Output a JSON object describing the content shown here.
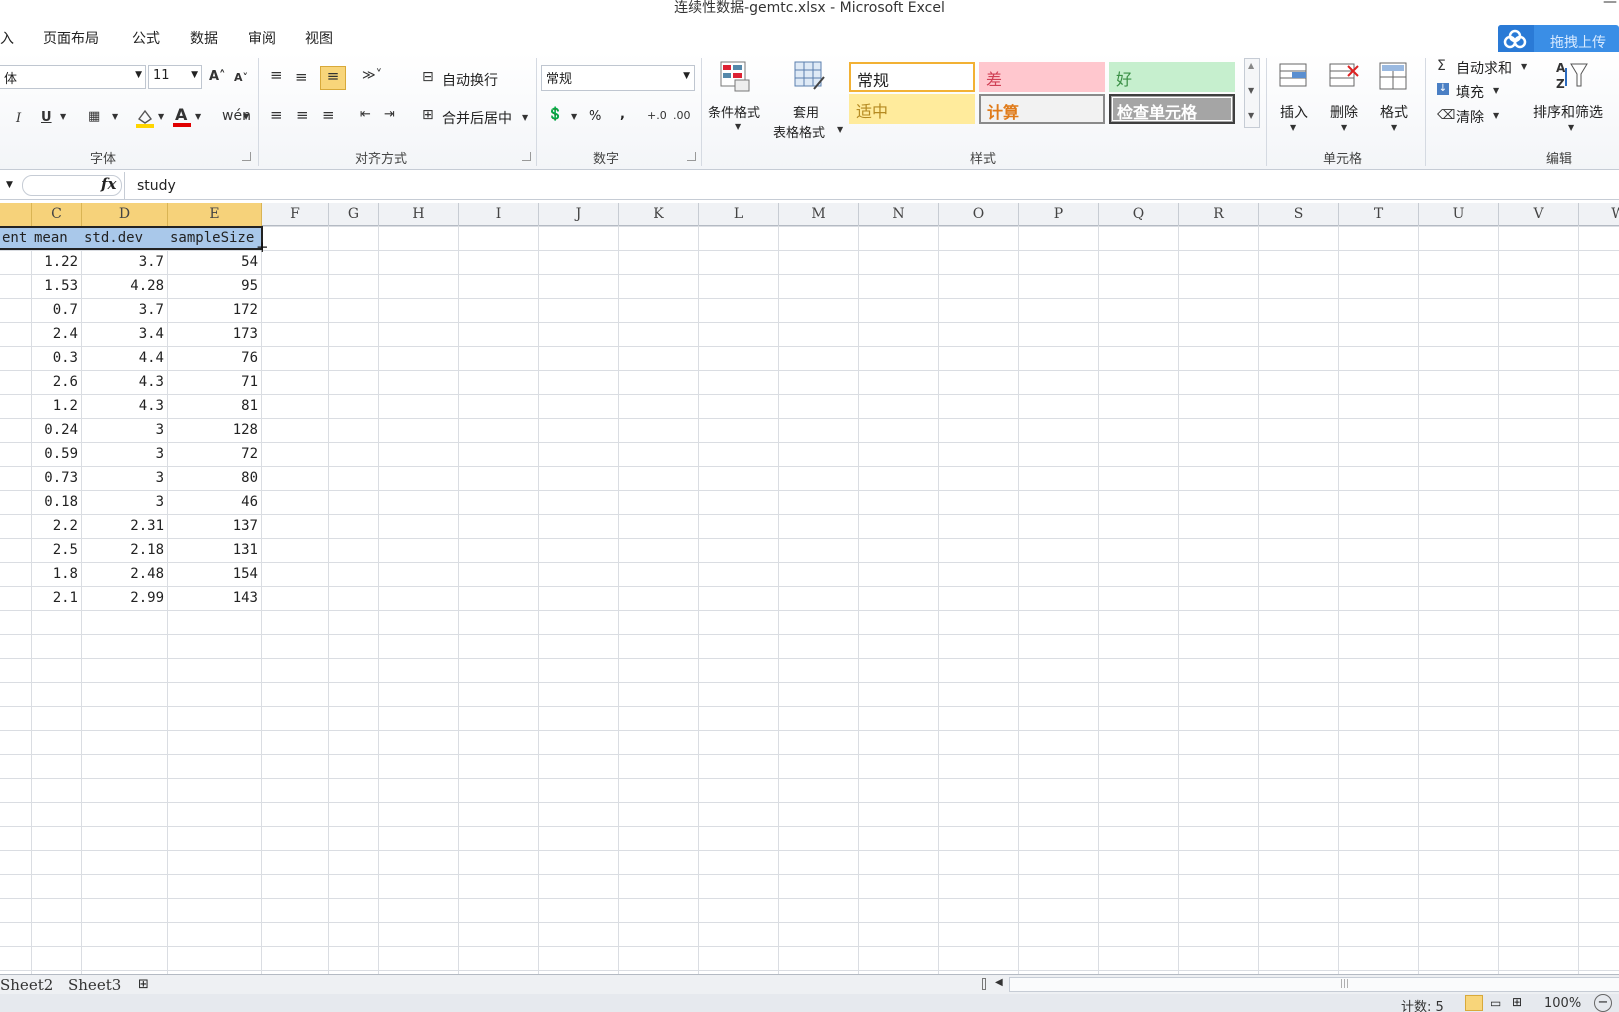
{
  "window": {
    "title": "连续性数据-gemtc.xlsx - Microsoft Excel"
  },
  "menu": {
    "tabs": [
      "入",
      "页面布局",
      "公式",
      "数据",
      "审阅",
      "视图"
    ]
  },
  "upload": {
    "label": "拖拽上传"
  },
  "ribbon": {
    "font": {
      "name": "体",
      "size": "11",
      "group_label": "字体"
    },
    "alignment": {
      "wrap_text": "自动换行",
      "merge_center": "合并后居中",
      "group_label": "对齐方式"
    },
    "number": {
      "format": "常规",
      "percent": "%",
      "comma": ",",
      "group_label": "数字"
    },
    "styles": {
      "conditional": "条件格式",
      "table_format_1": "套用",
      "table_format_2": "表格格式",
      "cells": [
        {
          "label": "常规",
          "bg": "#ffffff",
          "color": "#222222",
          "border": "#f2b134"
        },
        {
          "label": "差",
          "bg": "#ffc7ce",
          "color": "#d04055",
          "border": "#ffc7ce"
        },
        {
          "label": "好",
          "bg": "#c6efce",
          "color": "#3a8f45",
          "border": "#c6efce"
        },
        {
          "label": "适中",
          "bg": "#ffeb9c",
          "color": "#b58a21",
          "border": "#ffeb9c"
        },
        {
          "label": "计算",
          "bg": "#f2f2f2",
          "color": "#e07b1a",
          "border": "#8a8a8a"
        },
        {
          "label": "检查单元格",
          "bg": "#a5a5a5",
          "color": "#ffffff",
          "border": "#3f3f3f"
        }
      ],
      "group_label": "样式"
    },
    "cells": {
      "insert": "插入",
      "delete": "删除",
      "format": "格式",
      "group_label": "单元格"
    },
    "editing": {
      "autosum": "自动求和",
      "fill": "填充",
      "clear": "清除",
      "sort_filter": "排序和筛选",
      "group_label": "编辑"
    }
  },
  "formula_bar": {
    "value": "study"
  },
  "columns": [
    "C",
    "D",
    "E",
    "F",
    "G",
    "H",
    "I",
    "J",
    "K",
    "L",
    "M",
    "N",
    "O",
    "P",
    "Q",
    "R",
    "S",
    "T",
    "U",
    "V",
    "W"
  ],
  "table": {
    "header": [
      "ent",
      "mean",
      "std.dev",
      "sampleSize"
    ],
    "rows": [
      [
        "1.22",
        "3.7",
        "54"
      ],
      [
        "1.53",
        "4.28",
        "95"
      ],
      [
        "0.7",
        "3.7",
        "172"
      ],
      [
        "2.4",
        "3.4",
        "173"
      ],
      [
        "0.3",
        "4.4",
        "76"
      ],
      [
        "2.6",
        "4.3",
        "71"
      ],
      [
        "1.2",
        "4.3",
        "81"
      ],
      [
        "0.24",
        "3",
        "128"
      ],
      [
        "0.59",
        "3",
        "72"
      ],
      [
        "0.73",
        "3",
        "80"
      ],
      [
        "0.18",
        "3",
        "46"
      ],
      [
        "2.2",
        "2.31",
        "137"
      ],
      [
        "2.5",
        "2.18",
        "131"
      ],
      [
        "1.8",
        "2.48",
        "154"
      ],
      [
        "2.1",
        "2.99",
        "143"
      ]
    ]
  },
  "sheets": [
    "Sheet2",
    "Sheet3"
  ],
  "status": {
    "count": "计数: 5",
    "zoom": "100%"
  }
}
